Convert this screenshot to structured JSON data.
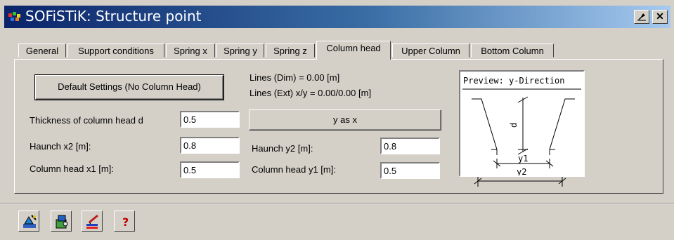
{
  "window": {
    "title": "SOFiSTiK: Structure point"
  },
  "tabs": [
    {
      "label": "General"
    },
    {
      "label": "Support conditions"
    },
    {
      "label": "Spring x"
    },
    {
      "label": "Spring y"
    },
    {
      "label": "Spring z"
    },
    {
      "label": "Column head"
    },
    {
      "label": "Upper Column"
    },
    {
      "label": "Bottom Column"
    }
  ],
  "active_tab": "Column head",
  "form": {
    "default_button": "Default Settings (No Column Head)",
    "lines_dim": "Lines (Dim) = 0.00 [m]",
    "lines_ext": "Lines (Ext) x/y = 0.00/0.00 [m]",
    "thickness_label": "Thickness of column head d",
    "thickness_value": "0.5",
    "y_as_x_button": "y as x",
    "haunch_x2_label": "Haunch x2 [m]:",
    "haunch_x2_value": "0.8",
    "haunch_y2_label": "Haunch y2 [m]:",
    "haunch_y2_value": "0.8",
    "column_head_x1_label": "Column head  x1 [m]:",
    "column_head_x1_value": "0.5",
    "column_head_y1_label": "Column head y1 [m]:",
    "column_head_y1_value": "0.5"
  },
  "preview": {
    "title": "Preview: y-Direction",
    "label_d": "d",
    "label_y1": "y1",
    "label_y2": "y2"
  },
  "toolbar": {
    "tools": [
      {
        "icon": "wizard-icon"
      },
      {
        "icon": "settings-icon"
      },
      {
        "icon": "draw-icon"
      },
      {
        "icon": "help-icon"
      }
    ]
  },
  "colors": {
    "titlebar_start": "#0a246a",
    "titlebar_end": "#a6caf0",
    "face": "#d4d0c8"
  }
}
